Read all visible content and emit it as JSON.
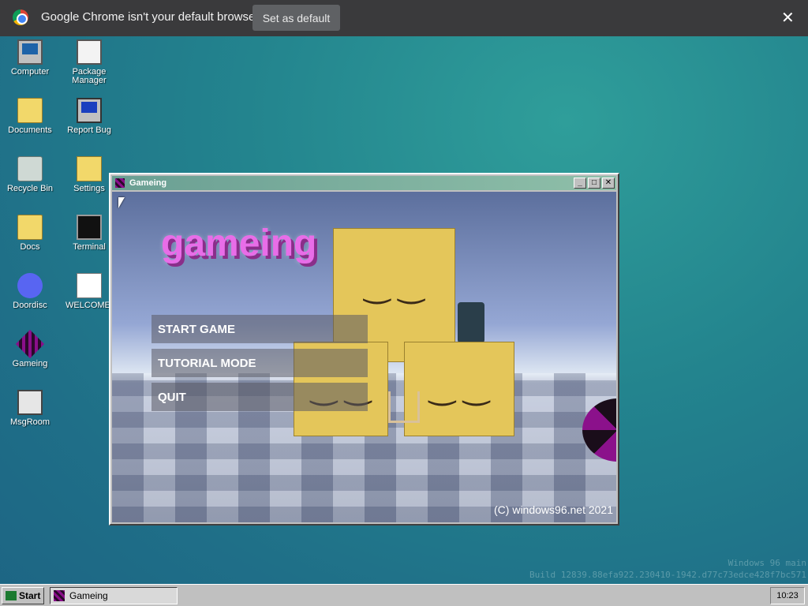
{
  "infobar": {
    "message": "Google Chrome isn't your default browser",
    "set_default_label": "Set as default",
    "close_glyph": "✕"
  },
  "desktop_icons": [
    {
      "label": "Computer",
      "icon": "computer-icon"
    },
    {
      "label": "Package Manager",
      "icon": "package-icon"
    },
    {
      "label": "Documents",
      "icon": "folder-icon"
    },
    {
      "label": "Report Bug",
      "icon": "report-icon"
    },
    {
      "label": "Recycle Bin",
      "icon": "recycle-icon"
    },
    {
      "label": "Settings",
      "icon": "settings-icon"
    },
    {
      "label": "Docs",
      "icon": "folder-icon"
    },
    {
      "label": "Terminal",
      "icon": "terminal-icon"
    },
    {
      "label": "Doordisc",
      "icon": "discord-icon"
    },
    {
      "label": "WELCOME.",
      "icon": "welcome-icon"
    },
    {
      "label": "Gameing",
      "icon": "gameing-icon"
    },
    {
      "label": "MsgRoom",
      "icon": "msgroom-icon"
    }
  ],
  "window": {
    "title": "Gameing",
    "min_glyph": "_",
    "max_glyph": "□",
    "close_glyph": "✕"
  },
  "game": {
    "title": "gameing",
    "menu": [
      "START GAME",
      "TUTORIAL MODE",
      "QUIT"
    ],
    "copyright": "(C) windows96.net 2021"
  },
  "watermark": {
    "line1": "Windows 96 main",
    "line2": "Build 12839.88efa922.230410-1942.d77c73edce428f7bc571"
  },
  "taskbar": {
    "start_label": "Start",
    "task_label": "Gameing",
    "clock": "10:23"
  },
  "colors": {
    "desktop": "#23848e",
    "title_magenta": "#e86de8",
    "taskbar": "#c0c0c0"
  }
}
